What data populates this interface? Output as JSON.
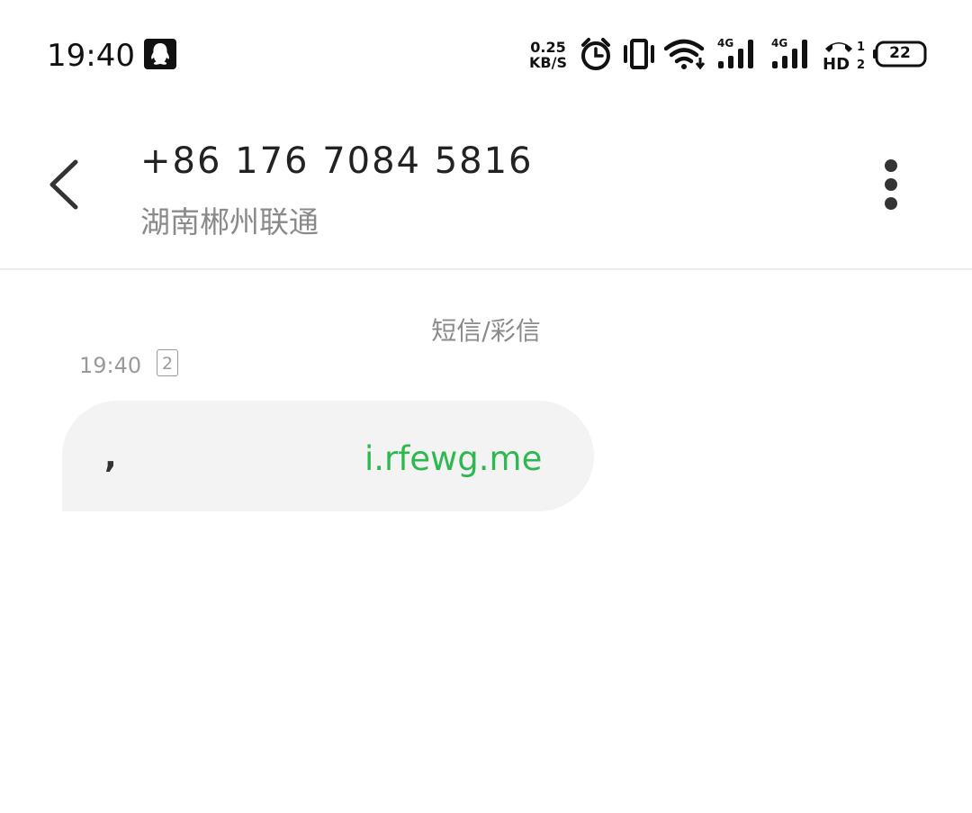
{
  "status_bar": {
    "time": "19:40",
    "net_speed_value": "0.25",
    "net_speed_unit": "KB/S",
    "signal_1_label": "4G",
    "signal_2_label": "4G",
    "hd_label": "HD",
    "hd_num_top": "1",
    "hd_num_bottom": "2",
    "battery": "22",
    "icons": [
      "qq-icon",
      "alarm-icon",
      "vibrate-icon",
      "wifi-icon",
      "signal-icon",
      "signal-icon",
      "hd-call-icon",
      "battery-icon"
    ]
  },
  "header": {
    "title": "+86 176 7084 5816",
    "subtitle": "湖南郴州联通"
  },
  "conversation": {
    "type_label": "短信/彩信",
    "message": {
      "time": "19:40",
      "sim": "2",
      "text_prefix": ",",
      "link": "i.rfewg.me"
    }
  },
  "colors": {
    "link": "#2fb84f",
    "bubble": "#f3f3f3",
    "secondary_text": "#8a8a8a"
  }
}
